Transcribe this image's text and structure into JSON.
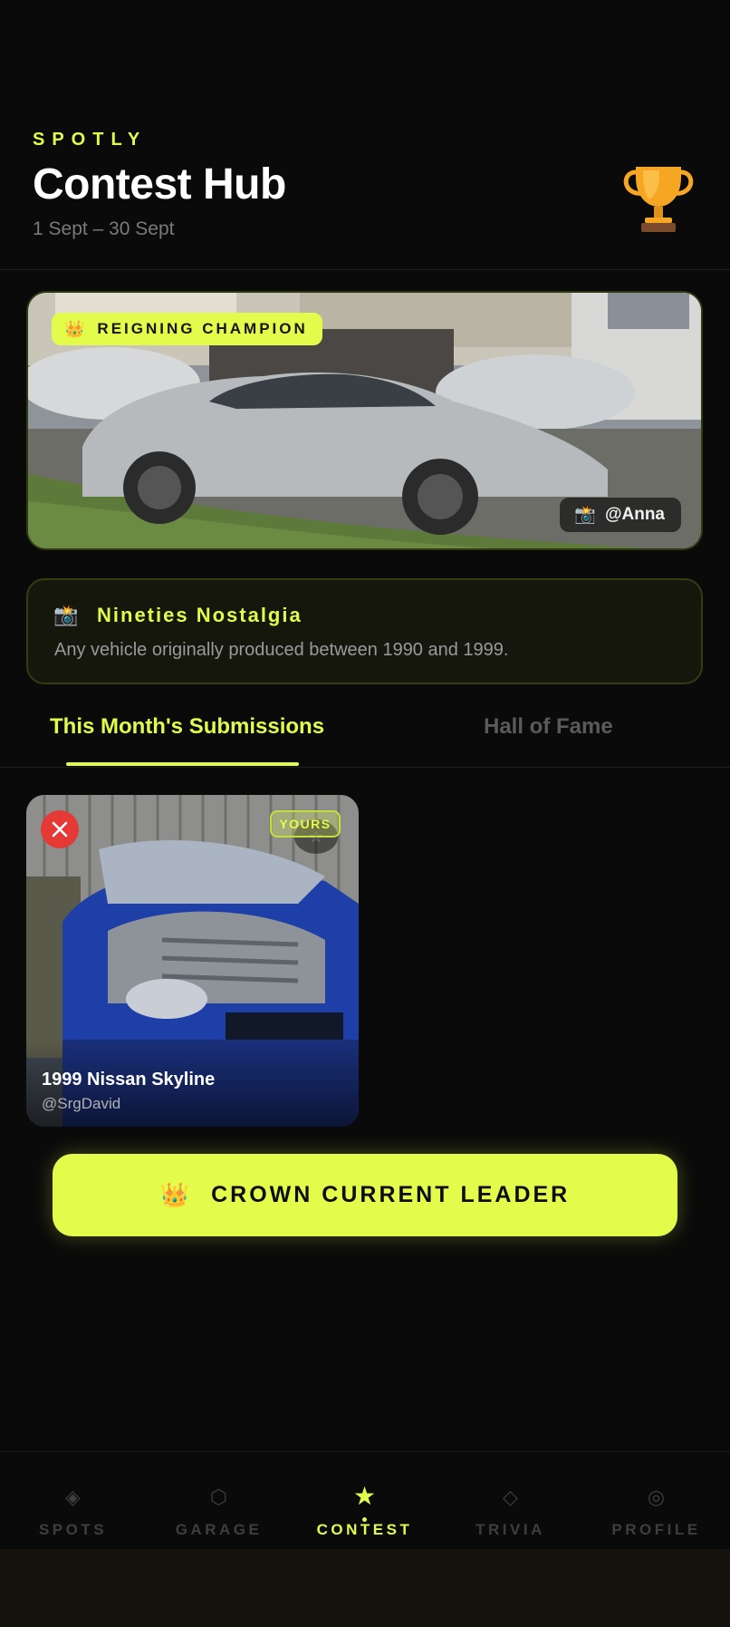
{
  "header": {
    "brand": "SPOTLY",
    "title": "Contest Hub",
    "dates": "1 Sept – 30 Sept"
  },
  "champion": {
    "badge_label": "REIGNING CHAMPION",
    "badge_icon": "crown-icon",
    "user": "@Anna",
    "user_icon": "camera-icon"
  },
  "theme": {
    "icon": "camera-flash-icon",
    "name": "Nineties Nostalgia",
    "description": "Any vehicle originally produced between 1990 and 1999."
  },
  "tabs": [
    {
      "label": "This Month's Submissions",
      "active": true
    },
    {
      "label": "Hall of Fame",
      "active": false
    }
  ],
  "submissions": [
    {
      "title": "1999 Nissan Skyline",
      "user": "@SrgDavid",
      "badge": "YOURS"
    }
  ],
  "cta": {
    "label": "CROWN CURRENT LEADER",
    "icon": "crown-icon"
  },
  "nav": [
    {
      "label": "SPOTS",
      "icon": "diamond-icon",
      "active": false
    },
    {
      "label": "GARAGE",
      "icon": "hexagon-icon",
      "active": false
    },
    {
      "label": "CONTEST",
      "icon": "star-icon",
      "active": true
    },
    {
      "label": "TRIVIA",
      "icon": "diamond-outline-icon",
      "active": false
    },
    {
      "label": "PROFILE",
      "icon": "ring-icon",
      "active": false
    }
  ],
  "colors": {
    "accent": "#e3fb4a",
    "background": "#0a0a0a",
    "danger": "#e53935"
  }
}
